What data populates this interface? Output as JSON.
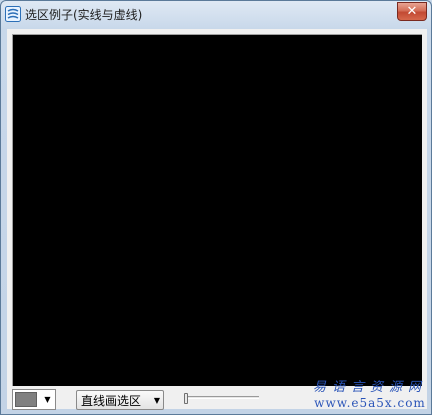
{
  "window": {
    "title": "选区例子(实线与虚线)",
    "close_label": "✕"
  },
  "canvas": {
    "background": "#000000"
  },
  "toolbar": {
    "color_value": "#808080",
    "dropdown_arrow": "▼",
    "mode_selected": "直线画选区",
    "slider_value": 0
  },
  "watermark": {
    "chinese": "易语言资源网",
    "url": "www.e5a5x.com"
  },
  "icons": {
    "app": "app-icon",
    "close": "close-icon",
    "dropdown": "chevron-down-icon"
  }
}
